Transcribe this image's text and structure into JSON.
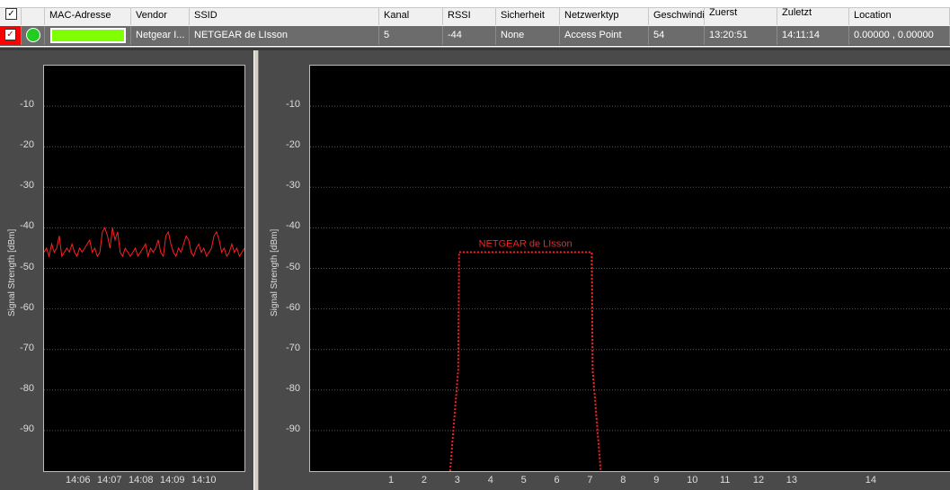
{
  "columns": [
    "MAC-Adresse",
    "Vendor",
    "SSID",
    "Kanal",
    "RSSI",
    "Sicherheit",
    "Netzwerktyp",
    "Geschwindi",
    "Zuerst",
    "Zuletzt",
    "Location"
  ],
  "row": {
    "vendor": "Netgear I...",
    "ssid": "NETGEAR de LIsson",
    "channel": "5",
    "rssi": "-44",
    "security": "None",
    "network_type": "Access Point",
    "speed": "54",
    "first_seen": "13:20:51",
    "last_seen": "14:11:14",
    "location": "0.00000 , 0.00000",
    "color": "#80ff00"
  },
  "colors": {
    "accent_line": "#ff2020",
    "plot_bg": "#000000",
    "panel_bg": "#4a4a4a"
  },
  "chart_data": [
    {
      "type": "line",
      "ylabel": "Signal Strength [dBm]",
      "y_ticks": [
        -10,
        -20,
        -30,
        -40,
        -50,
        -60,
        -70,
        -80,
        -90
      ],
      "ylim": [
        -100,
        0
      ],
      "x_ticks": [
        "14:06",
        "14:07",
        "14:08",
        "14:09",
        "14:10"
      ],
      "grid": true,
      "series": [
        {
          "values": [
            -46,
            -45,
            -47,
            -44,
            -46,
            -45,
            -42,
            -47,
            -46,
            -45,
            -46,
            -44,
            -46,
            -47,
            -45,
            -46,
            -45,
            -44,
            -43,
            -46,
            -45,
            -47,
            -46,
            -41,
            -40,
            -42,
            -45,
            -40,
            -43,
            -41,
            -46,
            -47,
            -45,
            -46,
            -47,
            -46,
            -45,
            -47,
            -46,
            -45,
            -44,
            -47,
            -45,
            -46,
            -45,
            -43,
            -46,
            -47,
            -42,
            -41,
            -44,
            -46,
            -47,
            -45,
            -46,
            -44,
            -42,
            -43,
            -46,
            -47,
            -45,
            -44,
            -46,
            -45,
            -47,
            -46,
            -45,
            -42,
            -41,
            -43,
            -46,
            -45,
            -47,
            -46,
            -44,
            -46,
            -45,
            -47,
            -46,
            -45
          ]
        }
      ]
    },
    {
      "type": "area",
      "ylabel": "Signal Strength [dBm]",
      "y_ticks": [
        -10,
        -20,
        -30,
        -40,
        -50,
        -60,
        -70,
        -80,
        -90
      ],
      "ylim": [
        -100,
        0
      ],
      "x_ticks": [
        "1",
        "2",
        "3",
        "4",
        "5",
        "6",
        "7",
        "8",
        "9",
        "10",
        "11",
        "12",
        "13",
        "14"
      ],
      "grid": true,
      "series": [
        {
          "name": "NETGEAR de LIsson",
          "channel_from": 3,
          "channel_to": 7,
          "top": -46
        }
      ]
    }
  ]
}
